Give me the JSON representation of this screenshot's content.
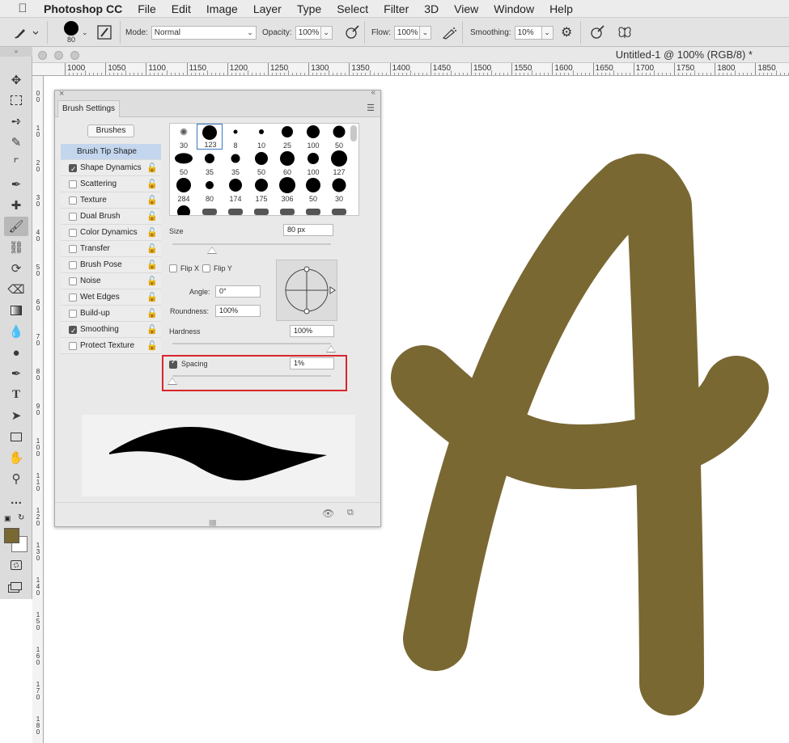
{
  "menubar": {
    "app_name": "Photoshop CC",
    "menus": [
      "File",
      "Edit",
      "Image",
      "Layer",
      "Type",
      "Select",
      "Filter",
      "3D",
      "View",
      "Window",
      "Help"
    ]
  },
  "options_bar": {
    "brush_size": "80",
    "mode_label": "Mode:",
    "mode_value": "Normal",
    "opacity_label": "Opacity:",
    "opacity_value": "100%",
    "flow_label": "Flow:",
    "flow_value": "100%",
    "smoothing_label": "Smoothing:",
    "smoothing_value": "10%"
  },
  "document": {
    "title": "Untitled-1 @ 100% (RGB/8) *"
  },
  "ruler": {
    "h_labels": [
      "1000",
      "1050",
      "1100",
      "1150",
      "1200",
      "1250",
      "1300",
      "1350",
      "1400",
      "1450",
      "1500",
      "1550",
      "1600",
      "1650",
      "1700",
      "1750",
      "1800",
      "1850"
    ],
    "v_labels": [
      "0",
      "1",
      "2",
      "3",
      "4",
      "5",
      "6",
      "7",
      "8",
      "9",
      "10",
      "11",
      "12",
      "13",
      "14",
      "15",
      "16",
      "17",
      "18"
    ]
  },
  "panel": {
    "tab_label": "Brush Settings",
    "brushes_button": "Brushes",
    "list": [
      {
        "label": "Brush Tip Shape",
        "selected": true
      },
      {
        "label": "Shape Dynamics",
        "checked": true
      },
      {
        "label": "Scattering",
        "checked": false
      },
      {
        "label": "Texture",
        "checked": false
      },
      {
        "label": "Dual Brush",
        "checked": false
      },
      {
        "label": "Color Dynamics",
        "checked": false
      },
      {
        "label": "Transfer",
        "checked": false
      },
      {
        "label": "Brush Pose",
        "checked": false
      },
      {
        "label": "Noise",
        "checked": false
      },
      {
        "label": "Wet Edges",
        "checked": false
      },
      {
        "label": "Build-up",
        "checked": false
      },
      {
        "label": "Smoothing",
        "checked": true
      },
      {
        "label": "Protect Texture",
        "checked": false
      }
    ],
    "tip_sizes": [
      "30",
      "123",
      "8",
      "10",
      "25",
      "100",
      "50",
      "50",
      "35",
      "35",
      "50",
      "60",
      "100",
      "127",
      "284",
      "80",
      "174",
      "175",
      "306",
      "50",
      "30"
    ],
    "size_label": "Size",
    "size_value": "80 px",
    "size_fraction": 0.25,
    "flip_x_label": "Flip X",
    "flip_y_label": "Flip Y",
    "angle_label": "Angle:",
    "angle_value": "0°",
    "roundness_label": "Roundness:",
    "roundness_value": "100%",
    "hardness_label": "Hardness",
    "hardness_value": "100%",
    "hardness_fraction": 1.0,
    "spacing_label": "Spacing",
    "spacing_value": "1%",
    "spacing_checked": true,
    "spacing_fraction": 0.0
  },
  "colors": {
    "foreground": "#7a6833",
    "stroke": "#7a6833",
    "highlight": "#d9252b",
    "selected_row": "#c3d6ee"
  }
}
